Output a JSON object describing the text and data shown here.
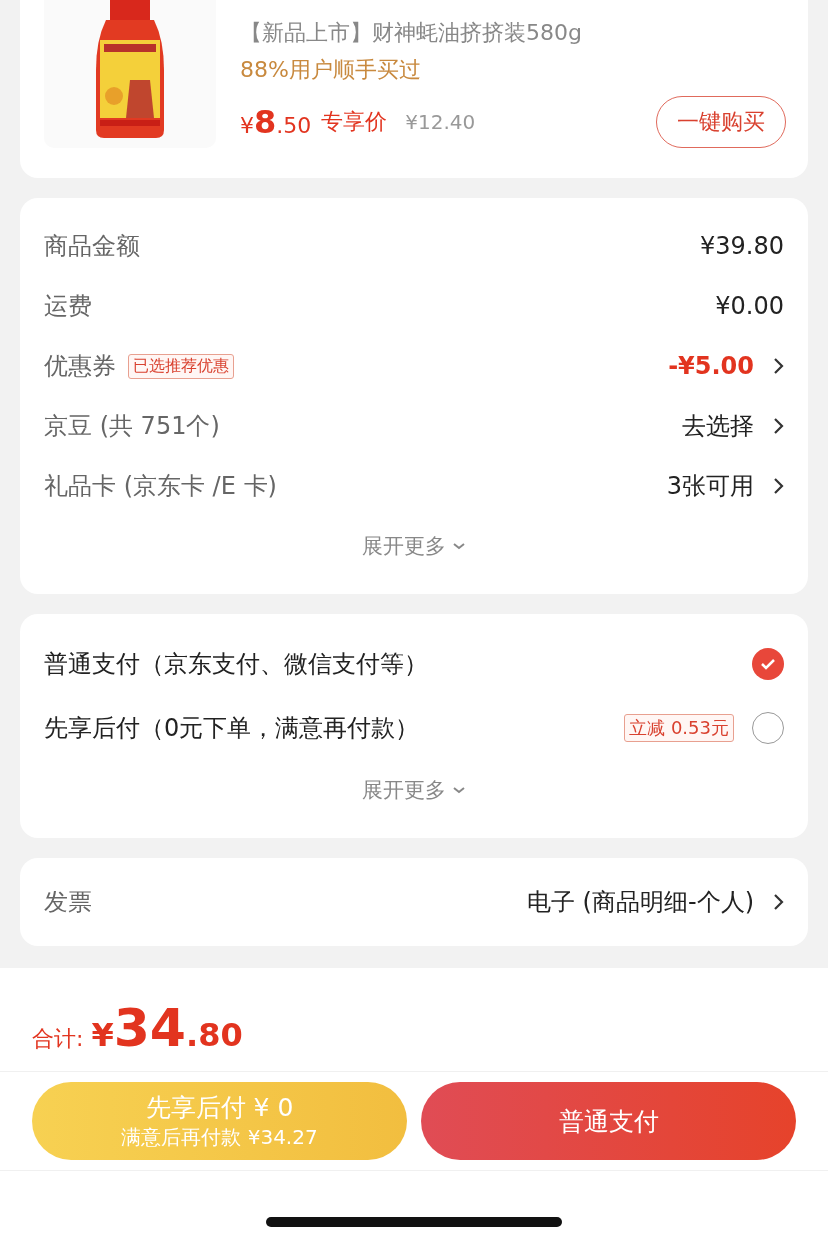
{
  "product": {
    "subtitle": "【新品上市】财神蚝油挤挤装580g",
    "social_proof": "88%用户顺手买过",
    "price": {
      "currency": "¥",
      "integer": "8",
      "decimal": ".50"
    },
    "price_label": "专享价",
    "original_price": "¥12.40",
    "buy_button": "一键购买"
  },
  "fees": [
    {
      "label": "商品金额",
      "value": "¥39.80",
      "kind": "plain",
      "arrow": false
    },
    {
      "label": "运费",
      "value": "¥0.00",
      "kind": "plain",
      "arrow": false
    },
    {
      "label": "优惠券",
      "tag": "已选推荐优惠",
      "value": "-¥5.00",
      "kind": "discount",
      "arrow": true
    },
    {
      "label": "京豆 (共 751个)",
      "value": "去选择",
      "kind": "plain",
      "arrow": true
    },
    {
      "label": "礼品卡 (京东卡 /E 卡)",
      "value": "3张可用",
      "kind": "plain",
      "arrow": true
    }
  ],
  "fees_expand": "展开更多",
  "payment_methods": [
    {
      "label": "普通支付（京东支付、微信支付等）",
      "selected": true
    },
    {
      "label": "先享后付（0元下单，满意再付款）",
      "tag": "立减 0.53元",
      "selected": false
    }
  ],
  "payment_expand": "展开更多",
  "invoice": {
    "label": "发票",
    "value": "电子 (商品明细-个人)"
  },
  "total": {
    "label": "合计:",
    "currency": "¥",
    "integer": "34",
    "decimal": ".80"
  },
  "actions": [
    {
      "kind": "later",
      "title": "先享后付 ¥ 0",
      "subtitle": "满意后再付款 ¥34.27"
    },
    {
      "kind": "now",
      "title": "普通支付"
    }
  ]
}
